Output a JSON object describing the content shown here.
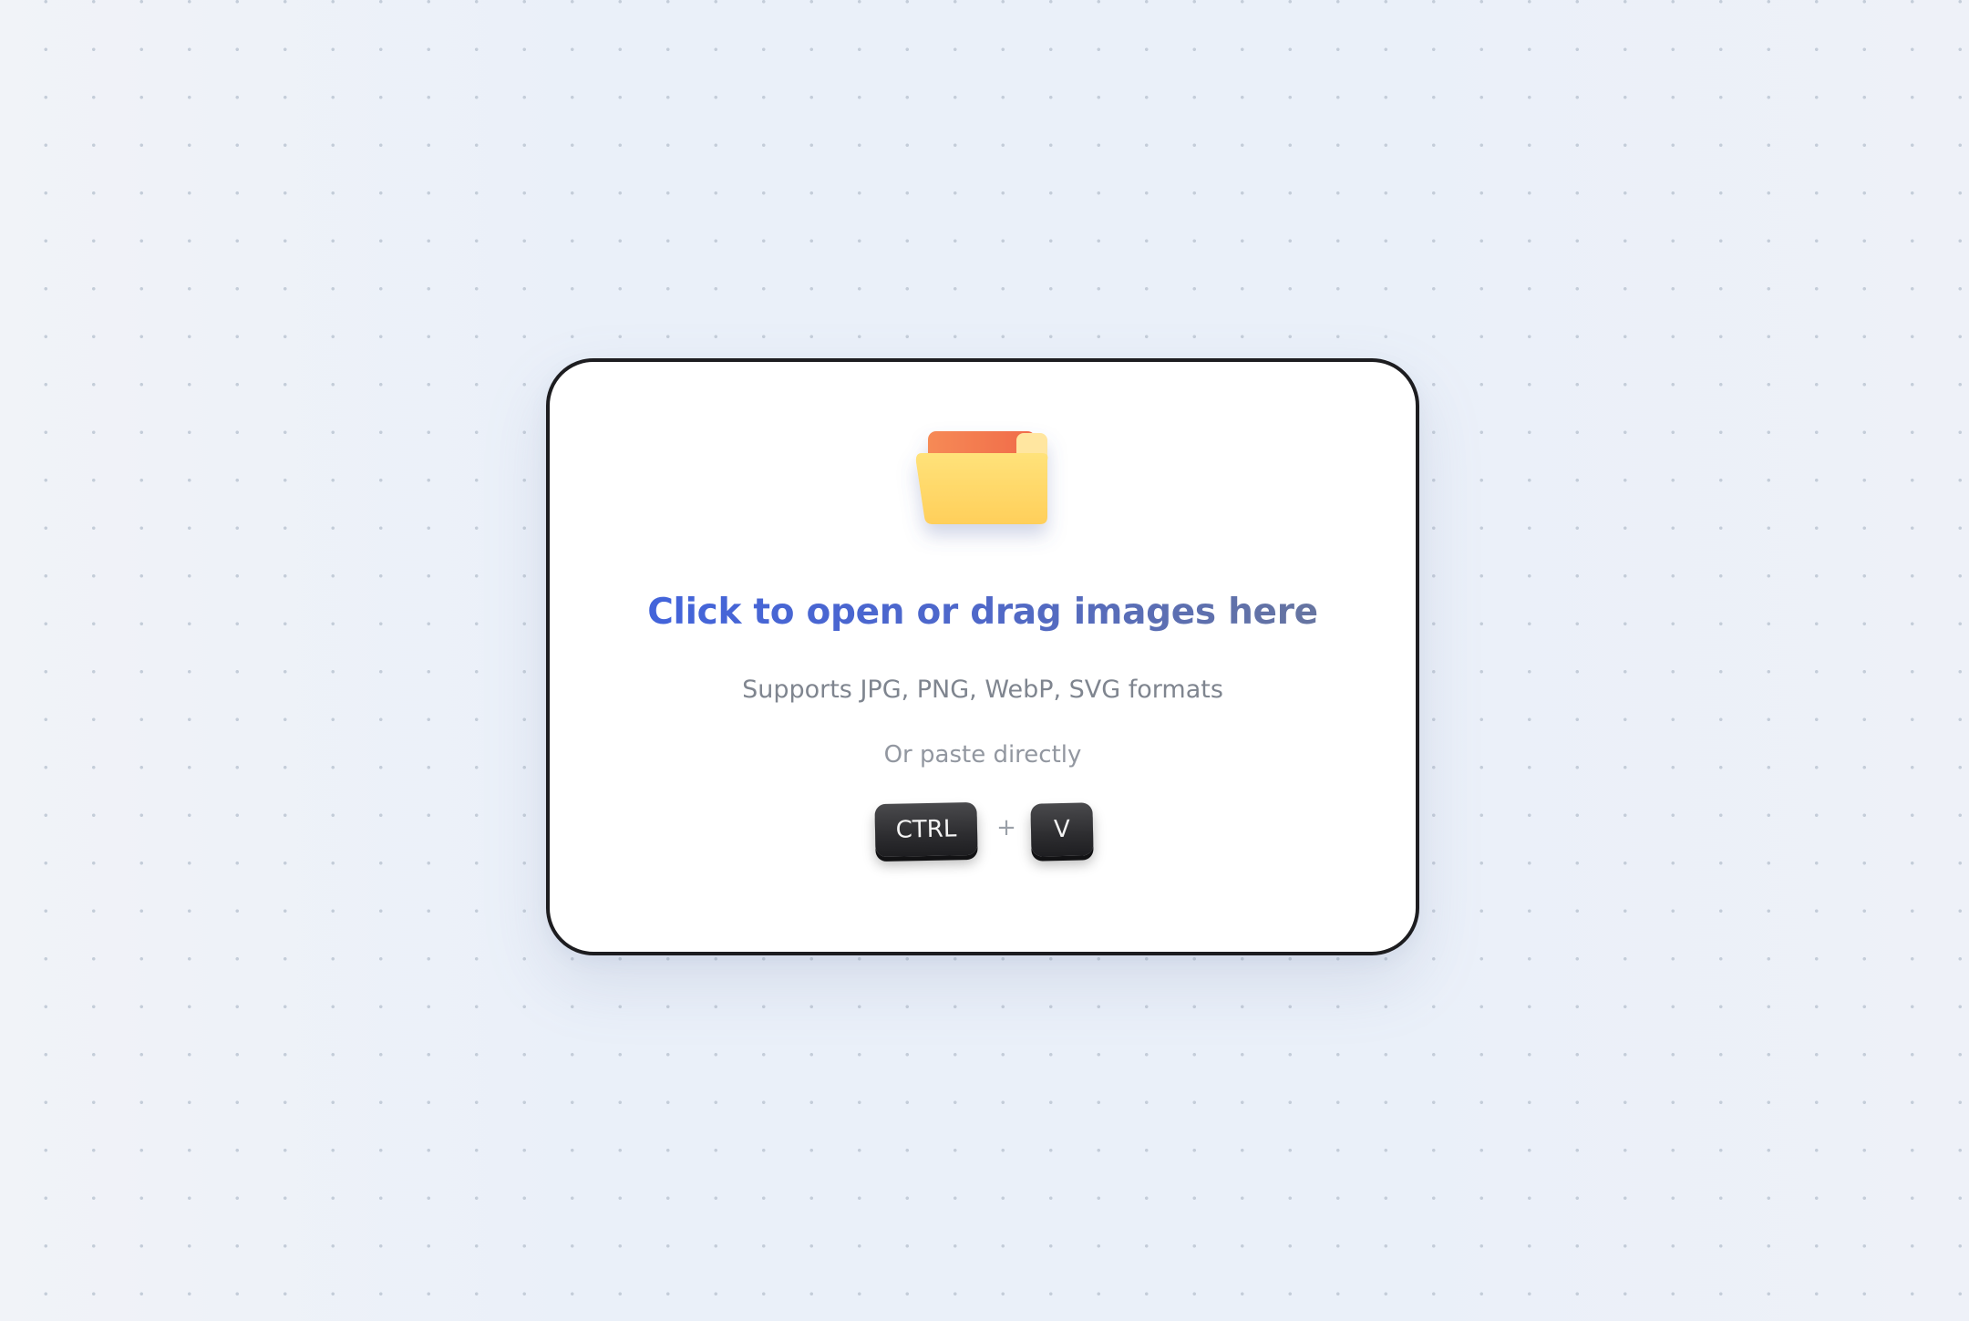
{
  "dropzone": {
    "icon": "folder-icon",
    "title": "Click to open or drag images here",
    "formats": "Supports JPG, PNG, WebP, SVG formats",
    "paste_hint": "Or paste directly",
    "shortcut": {
      "key1": "CTRL",
      "separator": "+",
      "key2": "V"
    }
  },
  "colors": {
    "title_gradient": [
      "#3f63e0",
      "#6d7894"
    ],
    "folder_body": "#ffd560",
    "folder_tab": "#f37650",
    "key_background": "#2d2d30"
  }
}
